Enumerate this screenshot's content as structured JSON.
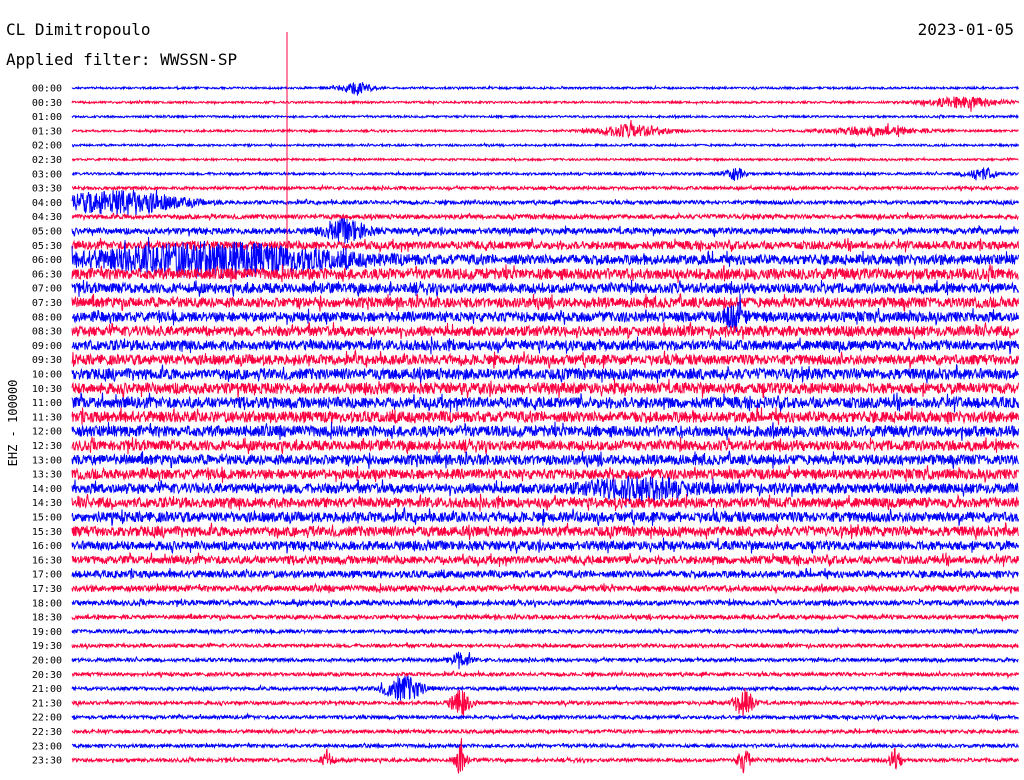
{
  "header": {
    "station": "CL Dimitropoulo",
    "date": "2023-01-05",
    "filter": "Applied filter: WWSSN-SP"
  },
  "chart_data": {
    "type": "line",
    "title": "CL Dimitropoulo",
    "subtitle": "Applied filter: WWSSN-SP",
    "date": "2023-01-05",
    "ylabel": "EHZ - 100000",
    "row_labels": [
      "00:00",
      "00:30",
      "01:00",
      "01:30",
      "02:00",
      "02:30",
      "03:00",
      "03:30",
      "04:00",
      "04:30",
      "05:00",
      "05:30",
      "06:00",
      "06:30",
      "07:00",
      "07:30",
      "08:00",
      "08:30",
      "09:00",
      "09:30",
      "10:00",
      "10:30",
      "11:00",
      "11:30",
      "12:00",
      "12:30",
      "13:00",
      "13:30",
      "14:00",
      "14:30",
      "15:00",
      "15:30",
      "16:00",
      "16:30",
      "17:00",
      "17:30",
      "18:00",
      "18:30",
      "19:00",
      "19:30",
      "20:00",
      "20:30",
      "21:00",
      "21:30",
      "22:00",
      "22:30",
      "23:00",
      "23:30"
    ],
    "row_colors": [
      "#0000ff",
      "#ff0040"
    ],
    "amplitude_levels": [
      1,
      1,
      1,
      1,
      1,
      1,
      1.2,
      1.5,
      1.8,
      2.2,
      3,
      4,
      5,
      5.5,
      5,
      5,
      5,
      5,
      5,
      5,
      5.5,
      5.5,
      5.5,
      5.5,
      5.5,
      5,
      5,
      5,
      5,
      5,
      5,
      5,
      4.5,
      4,
      3.5,
      3,
      2.5,
      2,
      1.8,
      1.7,
      1.7,
      1.7,
      1.7,
      1.7,
      1.7,
      1.7,
      1.7,
      1.7
    ],
    "events": [
      {
        "row": "00:00",
        "x_frac": 0.3,
        "amp": 6,
        "width_frac": 0.015
      },
      {
        "row": "00:30",
        "x_frac": 0.94,
        "amp": 5,
        "width_frac": 0.04
      },
      {
        "row": "01:30",
        "x_frac": 0.59,
        "amp": 6,
        "width_frac": 0.035
      },
      {
        "row": "01:30",
        "x_frac": 0.85,
        "amp": 4,
        "width_frac": 0.05
      },
      {
        "row": "03:00",
        "x_frac": 0.7,
        "amp": 6,
        "width_frac": 0.01
      },
      {
        "row": "03:00",
        "x_frac": 0.96,
        "amp": 6,
        "width_frac": 0.015
      },
      {
        "row": "04:00",
        "x_frac": 0.05,
        "amp": 12,
        "width_frac": 0.06
      },
      {
        "row": "05:00",
        "x_frac": 0.29,
        "amp": 10,
        "width_frac": 0.02
      },
      {
        "row": "06:00",
        "x_frac": 0.15,
        "amp": 14,
        "width_frac": 0.12
      },
      {
        "row": "08:00",
        "x_frac": 0.7,
        "amp": 12,
        "width_frac": 0.01
      },
      {
        "row": "14:00",
        "x_frac": 0.6,
        "amp": 9,
        "width_frac": 0.05
      },
      {
        "row": "20:00",
        "x_frac": 0.41,
        "amp": 8,
        "width_frac": 0.01
      },
      {
        "row": "21:00",
        "x_frac": 0.35,
        "amp": 12,
        "width_frac": 0.02
      },
      {
        "row": "21:30",
        "x_frac": 0.41,
        "amp": 12,
        "width_frac": 0.01
      },
      {
        "row": "21:30",
        "x_frac": 0.71,
        "amp": 14,
        "width_frac": 0.01
      },
      {
        "row": "23:30",
        "x_frac": 0.27,
        "amp": 10,
        "width_frac": 0.006
      },
      {
        "row": "23:30",
        "x_frac": 0.41,
        "amp": 14,
        "width_frac": 0.006
      },
      {
        "row": "23:30",
        "x_frac": 0.71,
        "amp": 14,
        "width_frac": 0.006
      },
      {
        "row": "23:30",
        "x_frac": 0.87,
        "amp": 10,
        "width_frac": 0.006
      }
    ]
  }
}
